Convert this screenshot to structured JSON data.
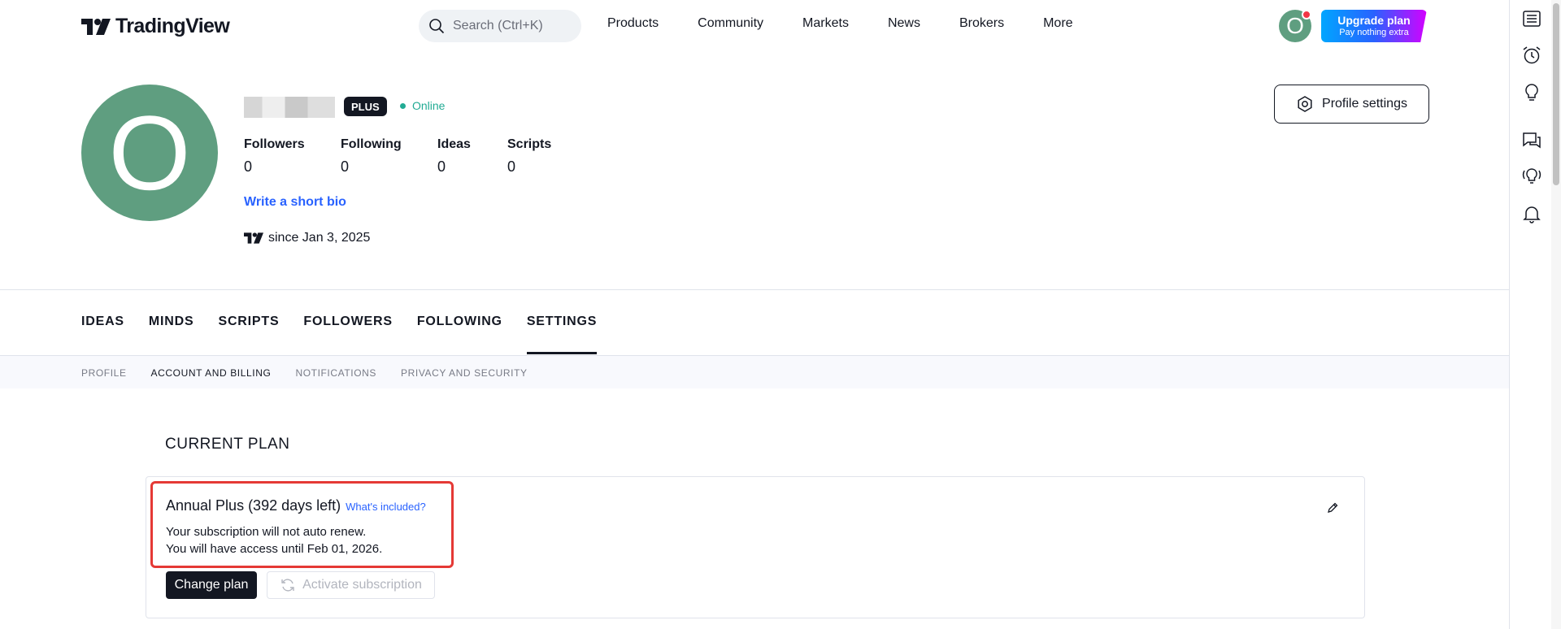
{
  "header": {
    "logo_text": "TradingView",
    "search_placeholder": "Search (Ctrl+K)",
    "nav": [
      "Products",
      "Community",
      "Markets",
      "News",
      "Brokers",
      "More"
    ],
    "avatar_letter": "O",
    "upgrade": {
      "title": "Upgrade plan",
      "subtitle": "Pay nothing extra"
    }
  },
  "profile": {
    "avatar_letter": "O",
    "badge": "PLUS",
    "status": "Online",
    "stats": [
      {
        "label": "Followers",
        "value": "0"
      },
      {
        "label": "Following",
        "value": "0"
      },
      {
        "label": "Ideas",
        "value": "0"
      },
      {
        "label": "Scripts",
        "value": "0"
      }
    ],
    "bio_link": "Write a short bio",
    "since": "since Jan 3, 2025",
    "settings_button": "Profile settings"
  },
  "tabs": [
    "IDEAS",
    "MINDS",
    "SCRIPTS",
    "FOLLOWERS",
    "FOLLOWING",
    "SETTINGS"
  ],
  "active_tab": "SETTINGS",
  "subtabs": [
    "PROFILE",
    "ACCOUNT AND BILLING",
    "NOTIFICATIONS",
    "PRIVACY AND SECURITY"
  ],
  "active_subtab": "ACCOUNT AND BILLING",
  "plan": {
    "heading": "CURRENT PLAN",
    "title": "Annual Plus (392 days left)",
    "whats_included": "What's included?",
    "line1": "Your subscription will not auto renew.",
    "line2": "You will have access until Feb 01, 2026.",
    "change_button": "Change plan",
    "activate_button": "Activate subscription"
  },
  "colors": {
    "accent_blue": "#2962ff",
    "avatar_green": "#5f9e80",
    "online_green": "#22ab94",
    "highlight_red": "#e53935"
  },
  "rightbar_icons": [
    "watchlist-icon",
    "alert-clock-icon",
    "ideas-bulb-icon",
    "chat-icon",
    "streams-bulb-icon",
    "notifications-bell-icon"
  ]
}
